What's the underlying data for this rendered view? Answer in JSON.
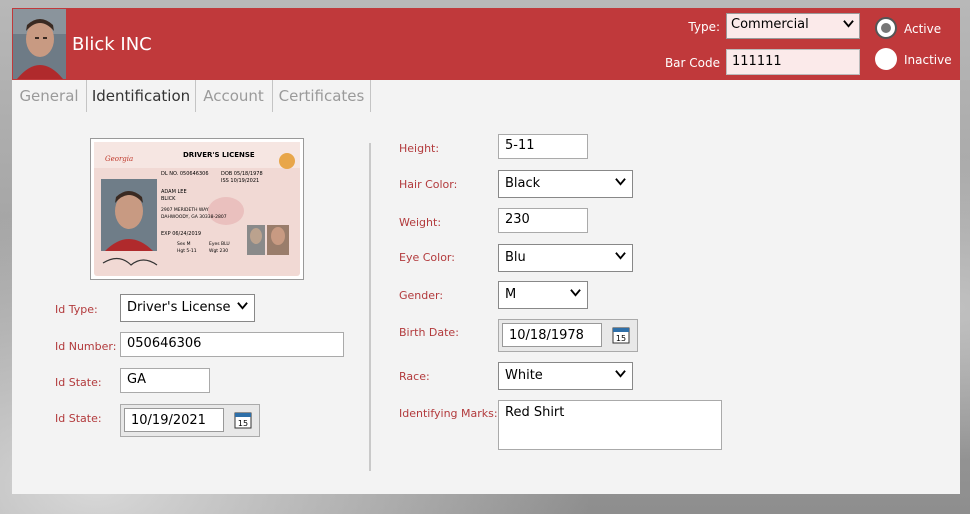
{
  "header": {
    "company_name": "Blick INC",
    "type_label": "Type:",
    "type_value": "Commercial",
    "barcode_label": "Bar Code",
    "barcode_value": "111111",
    "status_options": {
      "active": "Active",
      "inactive": "Inactive"
    },
    "status_selected": "active",
    "background_color": "#c0393b"
  },
  "tabs": [
    {
      "label": "General",
      "active": false
    },
    {
      "label": "Identification",
      "active": true
    },
    {
      "label": "Account",
      "active": false
    },
    {
      "label": "Certificates",
      "active": false
    }
  ],
  "id_card": {
    "state_name": "Georgia",
    "title": "DRIVER'S LICENSE",
    "dl_no": "DL NO. 050646306",
    "dob": "DOB 05/18/1978",
    "iss": "ISS 10/19/2021",
    "name_line1": "ADAM LEE",
    "name_line2": "BLICK",
    "address_line1": "2907 MERIDETH WAY",
    "address_line2": "DAHWOODY, GA 30338-2807",
    "exp": "EXP 06/24/2019",
    "sex": "Sex M",
    "eyes": "Eyes BLU",
    "height": "Hgt 5-11",
    "weight": "Wgt 230"
  },
  "left_form": {
    "id_type": {
      "label": "Id Type:",
      "value": "Driver's License"
    },
    "id_number": {
      "label": "Id Number:",
      "value": "050646306"
    },
    "id_state": {
      "label": "Id State:",
      "value": "GA"
    },
    "id_date": {
      "label": "Id State:",
      "value": "10/19/2021"
    }
  },
  "right_form": {
    "height": {
      "label": "Height:",
      "value": "5-11"
    },
    "hair_color": {
      "label": "Hair Color:",
      "value": "Black"
    },
    "weight": {
      "label": "Weight:",
      "value": "230"
    },
    "eye_color": {
      "label": "Eye Color:",
      "value": "Blu"
    },
    "gender": {
      "label": "Gender:",
      "value": "M"
    },
    "birth_date": {
      "label": "Birth Date:",
      "value": "10/18/1978"
    },
    "race": {
      "label": "Race:",
      "value": "White"
    },
    "identifying_marks": {
      "label": "Identifying Marks:",
      "value": "Red Shirt"
    }
  },
  "icons": {
    "calendar": "calendar-icon",
    "calendar_day": "15",
    "dropdown": "chevron-down-icon"
  },
  "colors": {
    "accent": "#c0393b",
    "label": "#b23a3c",
    "tab_inactive": "#9a9a9a",
    "field_highlight": "#fbeaea"
  }
}
